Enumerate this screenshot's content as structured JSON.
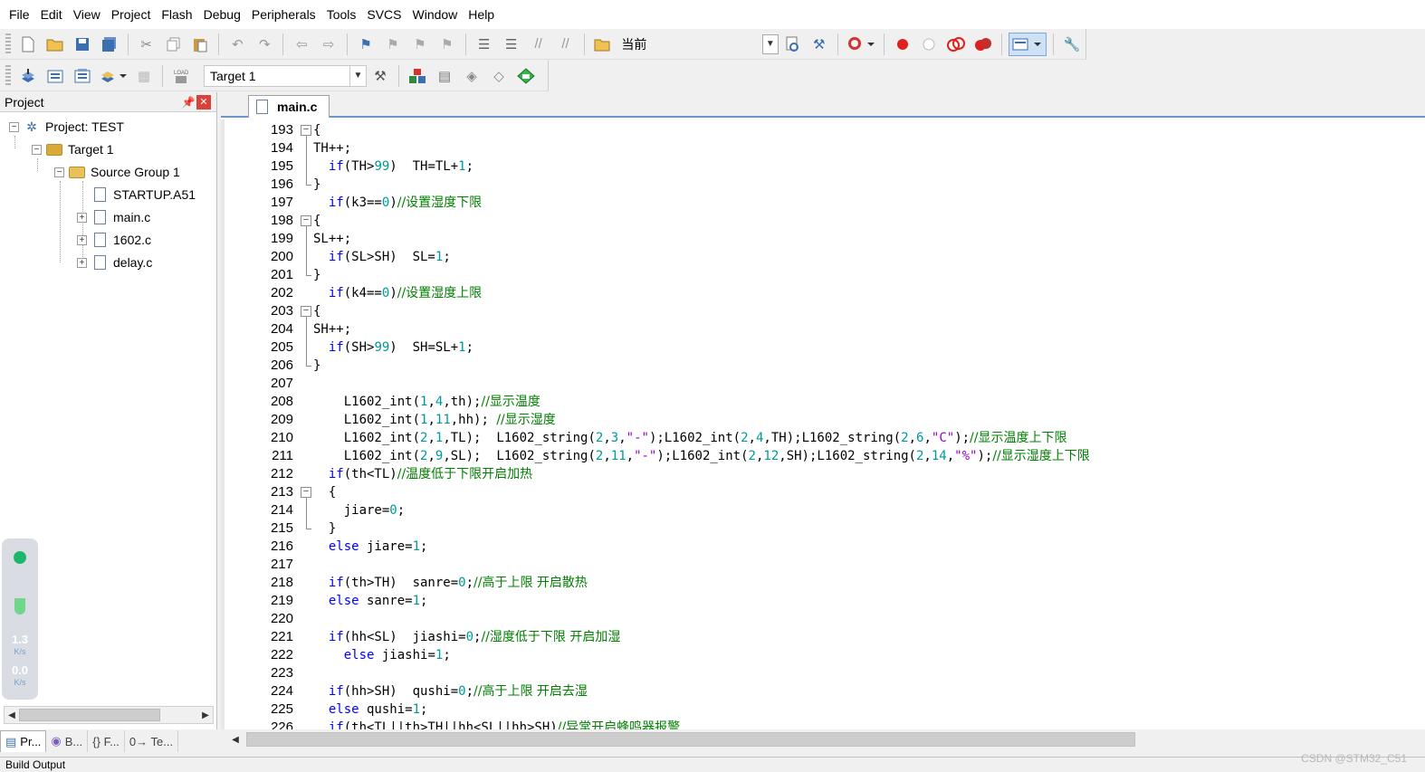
{
  "menu": [
    "File",
    "Edit",
    "View",
    "Project",
    "Flash",
    "Debug",
    "Peripherals",
    "Tools",
    "SVCS",
    "Window",
    "Help"
  ],
  "toolbar": {
    "find_combo_value": "当前",
    "target_combo_value": "Target 1"
  },
  "project_panel": {
    "title": "Project",
    "pin": "⬦",
    "close": "✕",
    "tree": [
      {
        "label": "Project: TEST",
        "icon": "project-icon"
      },
      {
        "label": "Target 1",
        "icon": "target-icon"
      },
      {
        "label": "Source Group 1",
        "icon": "folder-icon"
      },
      {
        "label": "STARTUP.A51",
        "icon": "file-icon"
      },
      {
        "label": "main.c",
        "icon": "file-icon"
      },
      {
        "label": "1602.c",
        "icon": "file-icon"
      },
      {
        "label": "delay.c",
        "icon": "file-icon"
      }
    ],
    "net_widget": {
      "up_value": "1.3",
      "up_unit": "K/s",
      "down_value": "0.0",
      "down_unit": "K/s"
    },
    "bottom_tabs": [
      "Pr...",
      "B...",
      "{} F...",
      "0→ Te..."
    ]
  },
  "editor": {
    "active_tab": "main.c",
    "lines": [
      {
        "n": "193",
        "fold": "−"
      },
      {
        "n": "194"
      },
      {
        "n": "195"
      },
      {
        "n": "196",
        "fold": "end"
      },
      {
        "n": "197"
      },
      {
        "n": "198",
        "fold": "−"
      },
      {
        "n": "199"
      },
      {
        "n": "200"
      },
      {
        "n": "201",
        "fold": "end"
      },
      {
        "n": "202"
      },
      {
        "n": "203",
        "fold": "−"
      },
      {
        "n": "204"
      },
      {
        "n": "205"
      },
      {
        "n": "206",
        "fold": "end"
      },
      {
        "n": "207"
      },
      {
        "n": "208"
      },
      {
        "n": "209"
      },
      {
        "n": "210"
      },
      {
        "n": "211"
      },
      {
        "n": "212"
      },
      {
        "n": "213",
        "fold": "−"
      },
      {
        "n": "214"
      },
      {
        "n": "215",
        "fold": "end"
      },
      {
        "n": "216"
      },
      {
        "n": "217"
      },
      {
        "n": "218"
      },
      {
        "n": "219"
      },
      {
        "n": "220"
      },
      {
        "n": "221"
      },
      {
        "n": "222"
      },
      {
        "n": "223"
      },
      {
        "n": "224"
      },
      {
        "n": "225"
      },
      {
        "n": "226"
      }
    ],
    "code": [
      [
        [
          "p",
          "{"
        ]
      ],
      [
        [
          "p",
          "TH++;"
        ]
      ],
      [
        [
          "p",
          "  "
        ],
        [
          "k",
          "if"
        ],
        [
          "p",
          "(TH>"
        ],
        [
          "n",
          "99"
        ],
        [
          "p",
          ")  TH=TL+"
        ],
        [
          "n",
          "1"
        ],
        [
          "p",
          ";"
        ]
      ],
      [
        [
          "p",
          "}"
        ]
      ],
      [
        [
          "p",
          "  "
        ],
        [
          "k",
          "if"
        ],
        [
          "p",
          "(k3=="
        ],
        [
          "n",
          "0"
        ],
        [
          "p",
          ")"
        ],
        [
          "c",
          "//设置湿度下限"
        ]
      ],
      [
        [
          "p",
          "{"
        ]
      ],
      [
        [
          "p",
          "SL++;"
        ]
      ],
      [
        [
          "p",
          "  "
        ],
        [
          "k",
          "if"
        ],
        [
          "p",
          "(SL>SH)  SL="
        ],
        [
          "n",
          "1"
        ],
        [
          "p",
          ";"
        ]
      ],
      [
        [
          "p",
          "}"
        ]
      ],
      [
        [
          "p",
          "  "
        ],
        [
          "k",
          "if"
        ],
        [
          "p",
          "(k4=="
        ],
        [
          "n",
          "0"
        ],
        [
          "p",
          ")"
        ],
        [
          "c",
          "//设置湿度上限"
        ]
      ],
      [
        [
          "p",
          "{"
        ]
      ],
      [
        [
          "p",
          "SH++;"
        ]
      ],
      [
        [
          "p",
          "  "
        ],
        [
          "k",
          "if"
        ],
        [
          "p",
          "(SH>"
        ],
        [
          "n",
          "99"
        ],
        [
          "p",
          ")  SH=SL+"
        ],
        [
          "n",
          "1"
        ],
        [
          "p",
          ";"
        ]
      ],
      [
        [
          "p",
          "}"
        ]
      ],
      [
        [
          "p",
          ""
        ]
      ],
      [
        [
          "p",
          "    L1602_int("
        ],
        [
          "n",
          "1"
        ],
        [
          "p",
          ","
        ],
        [
          "n",
          "4"
        ],
        [
          "p",
          ",th);"
        ],
        [
          "c",
          "//显示温度"
        ]
      ],
      [
        [
          "p",
          "    L1602_int("
        ],
        [
          "n",
          "1"
        ],
        [
          "p",
          ","
        ],
        [
          "n",
          "11"
        ],
        [
          "p",
          ",hh); "
        ],
        [
          "c",
          "//显示湿度"
        ]
      ],
      [
        [
          "p",
          "    L1602_int("
        ],
        [
          "n",
          "2"
        ],
        [
          "p",
          ","
        ],
        [
          "n",
          "1"
        ],
        [
          "p",
          ",TL);  L1602_string("
        ],
        [
          "n",
          "2"
        ],
        [
          "p",
          ","
        ],
        [
          "n",
          "3"
        ],
        [
          "p",
          ","
        ],
        [
          "s",
          "\"-\""
        ],
        [
          "p",
          ");L1602_int("
        ],
        [
          "n",
          "2"
        ],
        [
          "p",
          ","
        ],
        [
          "n",
          "4"
        ],
        [
          "p",
          ",TH);L1602_string("
        ],
        [
          "n",
          "2"
        ],
        [
          "p",
          ","
        ],
        [
          "n",
          "6"
        ],
        [
          "p",
          ","
        ],
        [
          "s",
          "\"C\""
        ],
        [
          "p",
          ");"
        ],
        [
          "c",
          "//显示温度上下限"
        ]
      ],
      [
        [
          "p",
          "    L1602_int("
        ],
        [
          "n",
          "2"
        ],
        [
          "p",
          ","
        ],
        [
          "n",
          "9"
        ],
        [
          "p",
          ",SL);  L1602_string("
        ],
        [
          "n",
          "2"
        ],
        [
          "p",
          ","
        ],
        [
          "n",
          "11"
        ],
        [
          "p",
          ","
        ],
        [
          "s",
          "\"-\""
        ],
        [
          "p",
          ");L1602_int("
        ],
        [
          "n",
          "2"
        ],
        [
          "p",
          ","
        ],
        [
          "n",
          "12"
        ],
        [
          "p",
          ",SH);L1602_string("
        ],
        [
          "n",
          "2"
        ],
        [
          "p",
          ","
        ],
        [
          "n",
          "14"
        ],
        [
          "p",
          ","
        ],
        [
          "s",
          "\"%\""
        ],
        [
          "p",
          ");"
        ],
        [
          "c",
          "//显示湿度上下限"
        ]
      ],
      [
        [
          "p",
          "  "
        ],
        [
          "k",
          "if"
        ],
        [
          "p",
          "(th<TL)"
        ],
        [
          "c",
          "//温度低于下限开启加热"
        ]
      ],
      [
        [
          "p",
          "  {"
        ]
      ],
      [
        [
          "p",
          "    jiare="
        ],
        [
          "n",
          "0"
        ],
        [
          "p",
          ";"
        ]
      ],
      [
        [
          "p",
          "  }"
        ]
      ],
      [
        [
          "p",
          "  "
        ],
        [
          "k",
          "else"
        ],
        [
          "p",
          " jiare="
        ],
        [
          "n",
          "1"
        ],
        [
          "p",
          ";"
        ]
      ],
      [
        [
          "p",
          ""
        ]
      ],
      [
        [
          "p",
          "  "
        ],
        [
          "k",
          "if"
        ],
        [
          "p",
          "(th>TH)  sanre="
        ],
        [
          "n",
          "0"
        ],
        [
          "p",
          ";"
        ],
        [
          "c",
          "//高于上限 开启散热"
        ]
      ],
      [
        [
          "p",
          "  "
        ],
        [
          "k",
          "else"
        ],
        [
          "p",
          " sanre="
        ],
        [
          "n",
          "1"
        ],
        [
          "p",
          ";"
        ]
      ],
      [
        [
          "p",
          ""
        ]
      ],
      [
        [
          "p",
          "  "
        ],
        [
          "k",
          "if"
        ],
        [
          "p",
          "(hh<SL)  jiashi="
        ],
        [
          "n",
          "0"
        ],
        [
          "p",
          ";"
        ],
        [
          "c",
          "//湿度低于下限 开启加湿"
        ]
      ],
      [
        [
          "p",
          "    "
        ],
        [
          "k",
          "else"
        ],
        [
          "p",
          " jiashi="
        ],
        [
          "n",
          "1"
        ],
        [
          "p",
          ";"
        ]
      ],
      [
        [
          "p",
          ""
        ]
      ],
      [
        [
          "p",
          "  "
        ],
        [
          "k",
          "if"
        ],
        [
          "p",
          "(hh>SH)  qushi="
        ],
        [
          "n",
          "0"
        ],
        [
          "p",
          ";"
        ],
        [
          "c",
          "//高于上限 开启去湿"
        ]
      ],
      [
        [
          "p",
          "  "
        ],
        [
          "k",
          "else"
        ],
        [
          "p",
          " qushi="
        ],
        [
          "n",
          "1"
        ],
        [
          "p",
          ";"
        ]
      ],
      [
        [
          "p",
          "  "
        ],
        [
          "k",
          "if"
        ],
        [
          "p",
          "(th<TL||th>TH||hh<SL||hh>SH)"
        ],
        [
          "c",
          "//异常开启蜂鸣器报警"
        ]
      ]
    ]
  },
  "build_output_title": "Build Output",
  "watermark": "CSDN @STM32_C51",
  "colors": {
    "keyword": "#0000ff",
    "number": "#009999",
    "string": "#9900cc",
    "comment": "#008000",
    "accent": "#6f96c8"
  }
}
